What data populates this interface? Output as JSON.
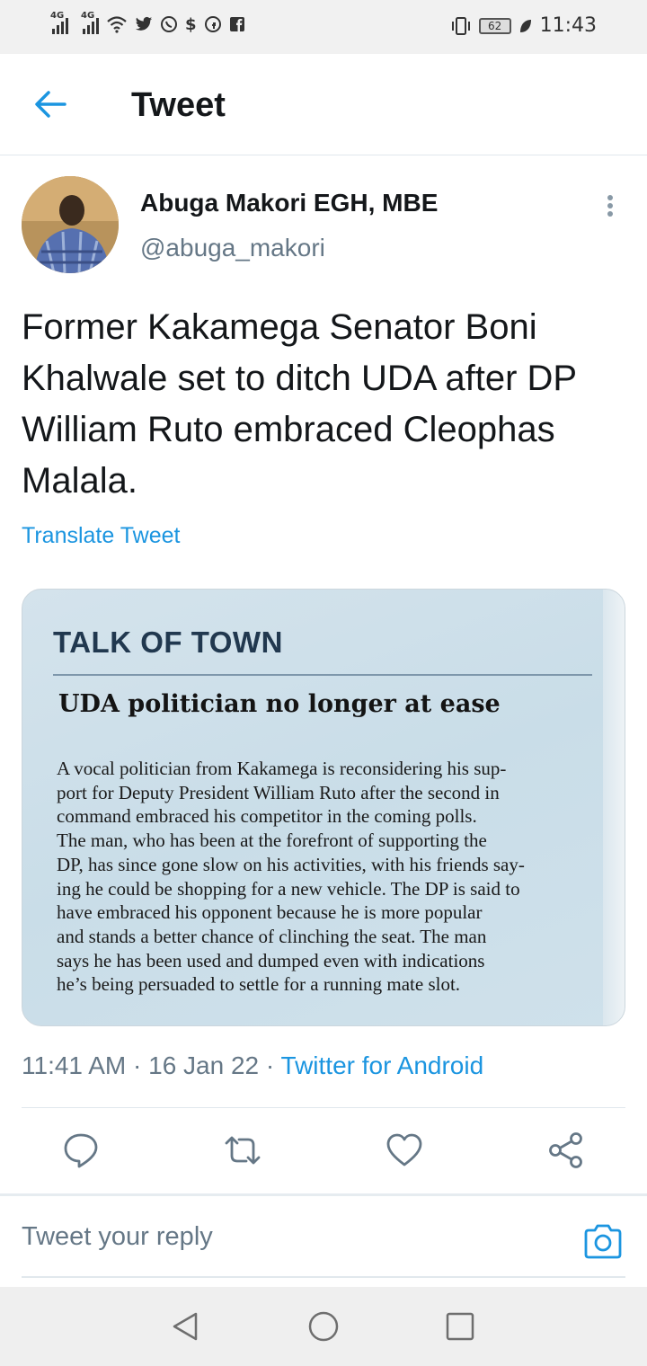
{
  "status_bar": {
    "signal_1": "4G",
    "signal_2": "4G",
    "battery": "62",
    "time": "11:43"
  },
  "header": {
    "title": "Tweet"
  },
  "author": {
    "name": "Abuga Makori EGH, MBE",
    "handle": "@abuga_makori"
  },
  "tweet": {
    "text": "Former Kakamega Senator Boni Khalwale set to ditch UDA after DP William Ruto embraced Cleophas Malala.",
    "translate_label": "Translate Tweet"
  },
  "media": {
    "kicker": "TALK OF TOWN",
    "headline": "UDA politician no longer at ease",
    "body_lines": [
      "A vocal politician from Kakamega is reconsidering his sup-",
      "port for Deputy President William Ruto after the second in",
      "command embraced his competitor in the coming polls.",
      "The man, who has been at the forefront of supporting the",
      "DP, has since gone slow on his activities, with his friends say-",
      "ing he could be shopping for a new vehicle. The DP is said to",
      "have embraced his opponent because he is more popular",
      "and stands a better chance of clinching the seat. The man",
      "says he has been used and dumped even with indications",
      "he’s being persuaded to settle for a running mate slot."
    ]
  },
  "meta": {
    "time": "11:41 AM",
    "separator": " · ",
    "date": "16 Jan 22",
    "source": "Twitter for Android"
  },
  "actions": {
    "reply_icon": "reply-icon",
    "retweet_icon": "retweet-icon",
    "like_icon": "heart-icon",
    "share_icon": "share-icon"
  },
  "reply": {
    "placeholder": "Tweet your reply"
  },
  "colors": {
    "accent": "#1b95e0",
    "text": "#14171a",
    "secondary": "#657786",
    "divider": "#e1e8ed"
  }
}
